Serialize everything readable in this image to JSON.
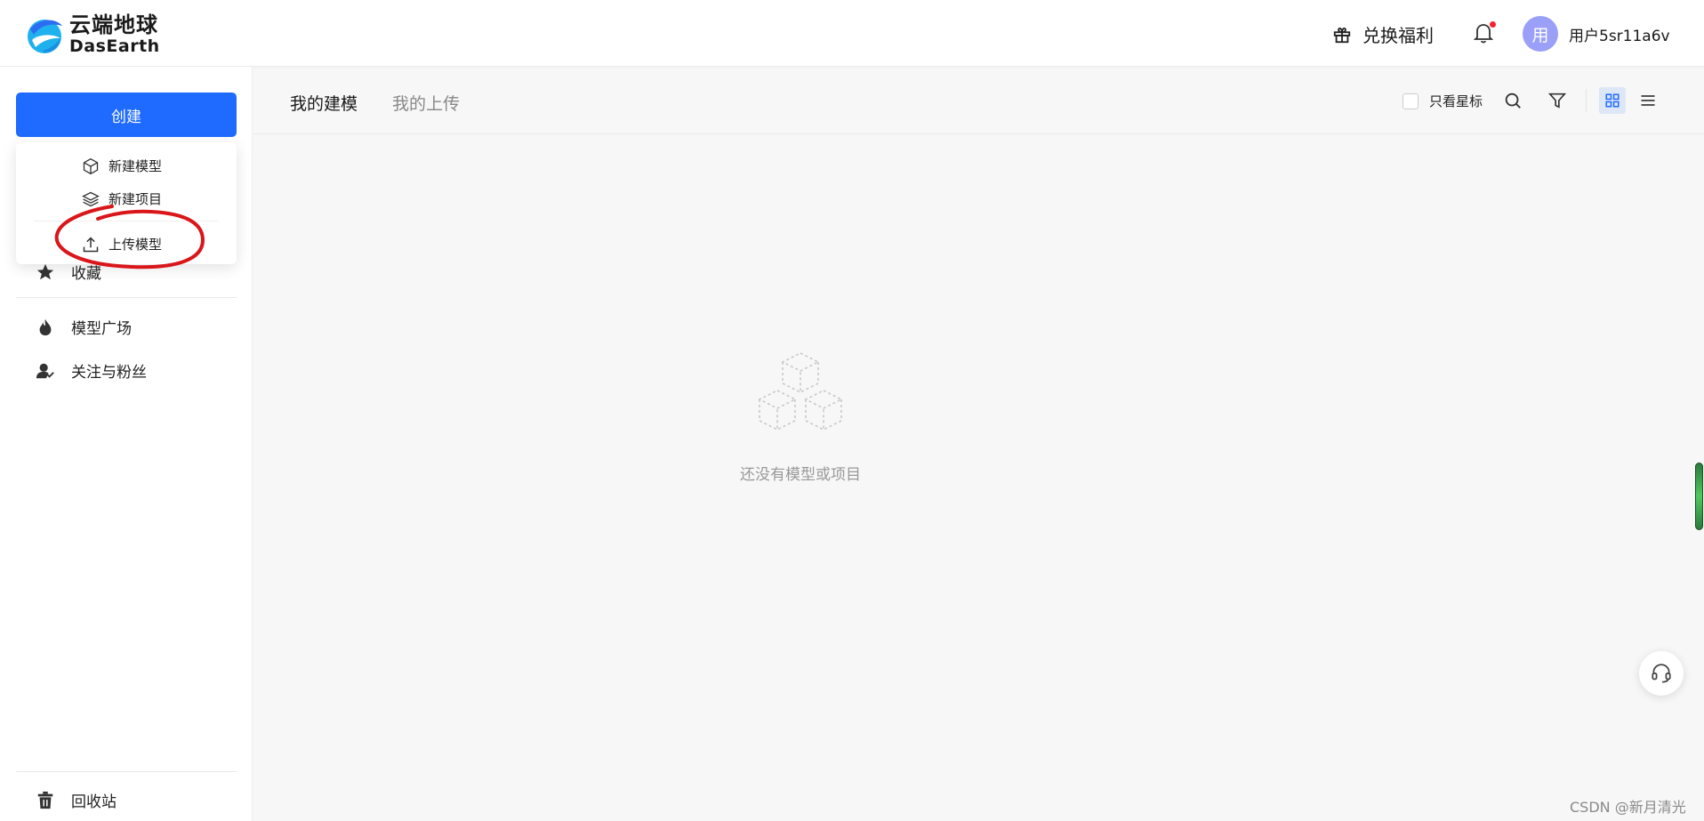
{
  "header": {
    "logo_cn": "云端地球",
    "logo_en": "DasEarth",
    "redeem_label": "兑换福利",
    "user": {
      "avatar_char": "用",
      "name": "用户5sr11a6v"
    }
  },
  "sidebar": {
    "create_label": "创建",
    "dropdown": [
      {
        "label": "新建模型",
        "icon": "cube-icon"
      },
      {
        "label": "新建项目",
        "icon": "layers-icon"
      },
      {
        "label": "上传模型",
        "icon": "upload-icon"
      }
    ],
    "nav": [
      {
        "label": "收藏",
        "icon": "star-icon"
      },
      {
        "label": "模型广场",
        "icon": "fire-icon"
      },
      {
        "label": "关注与粉丝",
        "icon": "user-follow-icon"
      }
    ],
    "recycle_label": "回收站"
  },
  "main": {
    "tabs": [
      {
        "label": "我的建模",
        "active": true
      },
      {
        "label": "我的上传",
        "active": false
      }
    ],
    "star_only_label": "只看星标",
    "empty_text": "还没有模型或项目"
  },
  "watermark": "CSDN @新月清光",
  "colors": {
    "primary": "#1f6bff",
    "annotation": "#d9161a",
    "avatar": "#9a9ff7"
  }
}
